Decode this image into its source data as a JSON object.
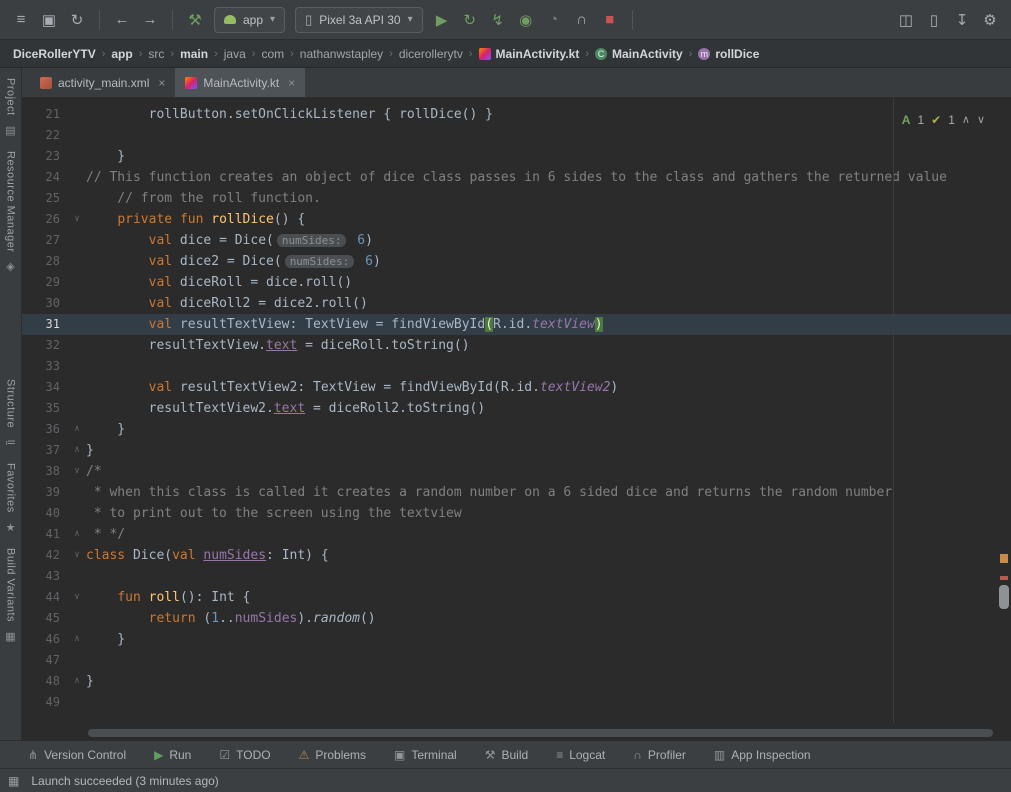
{
  "icons": {
    "menu": "≡",
    "save": "▣",
    "sync": "↻",
    "back": "←",
    "forward": "→",
    "build": "⚒",
    "caret": "▾",
    "phone": "▯",
    "run": "▶",
    "apply_changes": "↻",
    "apply_code": "↯",
    "debug": "◉",
    "profile": "◔",
    "profiler": "∩",
    "stop": "■",
    "attach_debugger": "◫",
    "avd": "▯",
    "sdk": "↧",
    "struct": "⚙",
    "vcs": "⋔",
    "todo": "☑",
    "problems": "⚠",
    "terminal": "▣",
    "logcat": "≡",
    "appinspect": "▥",
    "star": "★",
    "folder": "▤",
    "pin": "◈",
    "structure": "≔",
    "variants": "▦",
    "window": "▦",
    "chev_up": "∧",
    "chev_down": "∨",
    "close": "×",
    "a_badge": "A",
    "check": "✔"
  },
  "toolbar": {
    "run_config_label": "app",
    "device_label": "Pixel 3a API 30"
  },
  "breadcrumbs": {
    "sep": "›",
    "items": [
      {
        "label": "DiceRollerYTV",
        "cls": "bright"
      },
      {
        "label": "app",
        "cls": "bright"
      },
      {
        "label": "src",
        "cls": ""
      },
      {
        "label": "main",
        "cls": "bright"
      },
      {
        "label": "java",
        "cls": ""
      },
      {
        "label": "com",
        "cls": ""
      },
      {
        "label": "nathanwstapley",
        "cls": ""
      },
      {
        "label": "dicerollerytv",
        "cls": ""
      },
      {
        "label": "MainActivity.kt",
        "cls": "bright",
        "icon": "kotlin"
      },
      {
        "label": "MainActivity",
        "cls": "bright",
        "icon": "class",
        "icon_letter": "C"
      },
      {
        "label": "rollDice",
        "cls": "bright",
        "icon": "method",
        "icon_letter": "m"
      }
    ]
  },
  "tabs": [
    {
      "label": "activity_main.xml",
      "icon": "layout",
      "active": false
    },
    {
      "label": "MainActivity.kt",
      "icon": "kotlin",
      "active": true
    }
  ],
  "sidebar": {
    "items": [
      {
        "label": "Project",
        "icon": "folder",
        "gap_before": false
      },
      {
        "label": "Resource Manager",
        "icon": "pin",
        "gap_before": false
      },
      {
        "label": "Structure",
        "icon": "structure",
        "gap_before": true
      },
      {
        "label": "Favorites",
        "icon": "star",
        "gap_before": false
      },
      {
        "label": "Build Variants",
        "icon": "variants",
        "gap_before": false
      }
    ]
  },
  "inspection": {
    "a_count": "1",
    "check_count": "1"
  },
  "editor": {
    "lines": [
      {
        "n": 21,
        "tk": [
          [
            "        rollButton.setOnClickListener { rollDice() }",
            "pl"
          ]
        ]
      },
      {
        "n": 22,
        "tk": []
      },
      {
        "n": 23,
        "tk": [
          [
            "    }",
            "pl"
          ]
        ]
      },
      {
        "n": 24,
        "tk": [
          [
            "// This function creates an object of dice class passes in 6 sides to the class and gathers the returned value",
            "cm"
          ]
        ]
      },
      {
        "n": 25,
        "tk": [
          [
            "    // from the roll function.",
            "cm"
          ]
        ]
      },
      {
        "n": 26,
        "fold": "v",
        "tk": [
          [
            "    ",
            "pl"
          ],
          [
            "private",
            "kw"
          ],
          [
            " ",
            "pl"
          ],
          [
            "fun",
            "kw"
          ],
          [
            " ",
            "pl"
          ],
          [
            "rollDice",
            "fn"
          ],
          [
            "() {",
            "pl"
          ]
        ]
      },
      {
        "n": 27,
        "tk": [
          [
            "        ",
            "pl"
          ],
          [
            "val",
            "kw"
          ],
          [
            " dice = Dice(",
            "pl"
          ],
          [
            "numSides:",
            "hint"
          ],
          [
            " ",
            "pl"
          ],
          [
            "6",
            "num"
          ],
          [
            ")",
            "pl"
          ]
        ]
      },
      {
        "n": 28,
        "tk": [
          [
            "        ",
            "pl"
          ],
          [
            "val",
            "kw"
          ],
          [
            " dice2 = Dice(",
            "pl"
          ],
          [
            "numSides:",
            "hint"
          ],
          [
            " ",
            "pl"
          ],
          [
            "6",
            "num"
          ],
          [
            ")",
            "pl"
          ]
        ]
      },
      {
        "n": 29,
        "tk": [
          [
            "        ",
            "pl"
          ],
          [
            "val",
            "kw"
          ],
          [
            " diceRoll = dice.roll()",
            "pl"
          ]
        ]
      },
      {
        "n": 30,
        "tk": [
          [
            "        ",
            "pl"
          ],
          [
            "val",
            "kw"
          ],
          [
            " diceRoll2 = dice2.roll()",
            "pl"
          ]
        ]
      },
      {
        "n": 31,
        "hl": true,
        "tk": [
          [
            "        ",
            "pl"
          ],
          [
            "val",
            "kw"
          ],
          [
            " resultTextView: TextView = findViewById",
            "pl"
          ],
          [
            "(",
            "paren"
          ],
          [
            "R.id.",
            "pl"
          ],
          [
            "textView",
            "propi"
          ],
          [
            ")",
            "paren"
          ]
        ]
      },
      {
        "n": 32,
        "tk": [
          [
            "        resultTextView.",
            "pl"
          ],
          [
            "text",
            "propu"
          ],
          [
            " = diceRoll.toString()",
            "pl"
          ]
        ]
      },
      {
        "n": 33,
        "tk": []
      },
      {
        "n": 34,
        "tk": [
          [
            "        ",
            "pl"
          ],
          [
            "val",
            "kw"
          ],
          [
            " resultTextView2: TextView = findViewById(R.id.",
            "pl"
          ],
          [
            "textView2",
            "propi"
          ],
          [
            ")",
            "pl"
          ]
        ]
      },
      {
        "n": 35,
        "tk": [
          [
            "        resultTextView2.",
            "pl"
          ],
          [
            "text",
            "propu"
          ],
          [
            " = diceRoll2.toString()",
            "pl"
          ]
        ]
      },
      {
        "n": 36,
        "fold": "u",
        "tk": [
          [
            "    }",
            "pl"
          ]
        ]
      },
      {
        "n": 37,
        "fold": "u",
        "tk": [
          [
            "}",
            "pl"
          ]
        ]
      },
      {
        "n": 38,
        "fold": "v",
        "tk": [
          [
            "/*",
            "cm"
          ]
        ]
      },
      {
        "n": 39,
        "tk": [
          [
            " * when this class is called it creates a random number on a 6 sided dice and returns the random number",
            "cm"
          ]
        ]
      },
      {
        "n": 40,
        "tk": [
          [
            " * to print out to the screen using the textview",
            "cm"
          ]
        ]
      },
      {
        "n": 41,
        "fold": "u",
        "tk": [
          [
            " * */",
            "cm"
          ]
        ]
      },
      {
        "n": 42,
        "fold": "v",
        "tk": [
          [
            "class",
            "kw"
          ],
          [
            " Dice(",
            "pl"
          ],
          [
            "val",
            "kw"
          ],
          [
            " ",
            "pl"
          ],
          [
            "numSides",
            "propu"
          ],
          [
            ": Int) {",
            "pl"
          ]
        ]
      },
      {
        "n": 43,
        "tk": []
      },
      {
        "n": 44,
        "fold": "v",
        "tk": [
          [
            "    ",
            "pl"
          ],
          [
            "fun",
            "kw"
          ],
          [
            " ",
            "pl"
          ],
          [
            "roll",
            "fn"
          ],
          [
            "(): Int {",
            "pl"
          ]
        ]
      },
      {
        "n": 45,
        "tk": [
          [
            "        ",
            "pl"
          ],
          [
            "return",
            "kw"
          ],
          [
            " (",
            "pl"
          ],
          [
            "1",
            "num"
          ],
          [
            "..",
            "pl"
          ],
          [
            "numSides",
            "prop"
          ],
          [
            ").",
            "pl"
          ],
          [
            "random",
            "ital"
          ],
          [
            "()",
            "pl"
          ]
        ]
      },
      {
        "n": 46,
        "fold": "u",
        "tk": [
          [
            "    }",
            "pl"
          ]
        ]
      },
      {
        "n": 47,
        "tk": []
      },
      {
        "n": 48,
        "fold": "u",
        "tk": [
          [
            "}",
            "pl"
          ]
        ]
      },
      {
        "n": 49,
        "tk": []
      }
    ]
  },
  "bottom_bar": {
    "items": [
      {
        "label": "Version Control",
        "icon": "vcs",
        "cls": ""
      },
      {
        "label": "Run",
        "icon": "run",
        "cls": "green"
      },
      {
        "label": "TODO",
        "icon": "todo",
        "cls": ""
      },
      {
        "label": "Problems",
        "icon": "problems",
        "cls": "warn"
      },
      {
        "label": "Terminal",
        "icon": "terminal",
        "cls": ""
      },
      {
        "label": "Build",
        "icon": "build",
        "cls": ""
      },
      {
        "label": "Logcat",
        "icon": "logcat",
        "cls": ""
      },
      {
        "label": "Profiler",
        "icon": "profiler",
        "cls": ""
      },
      {
        "label": "App Inspection",
        "icon": "appinspect",
        "cls": ""
      }
    ]
  },
  "status_bar": {
    "message": "Launch succeeded (3 minutes ago)"
  }
}
